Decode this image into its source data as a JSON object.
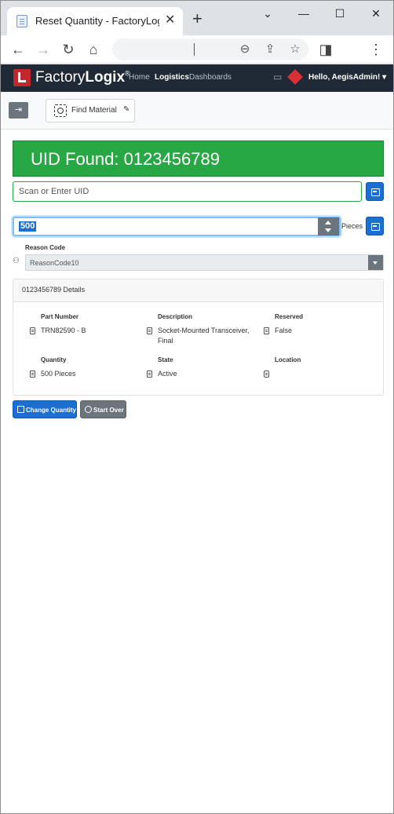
{
  "browser": {
    "tab_title": "Reset Quantity - FactoryLogix",
    "tab_close": "✕",
    "new_tab": "+",
    "minimize": "—",
    "maximize": "☐",
    "close": "✕"
  },
  "nav": {
    "brand_regular": "Factory",
    "brand_bold": "Logix",
    "brand_mark": "®",
    "links": [
      "Home",
      "Logistics",
      "Dashboards"
    ],
    "active_link": "Logistics",
    "user": "Hello, AegisAdmin! ▾"
  },
  "actionbar": {
    "find_material_label": "Find Material"
  },
  "main": {
    "found_text": "UID Found: 0123456789",
    "uid_placeholder": "Scan or Enter UID",
    "quantity_value": "500",
    "pieces_label": "Pieces",
    "reason_code_label": "Reason Code",
    "reason_code_value": "ReasonCode10"
  },
  "details": {
    "title": "0123456789 Details",
    "part_number_label": "Part Number",
    "part_number_value": "TRN82590 - B",
    "description_label": "Description",
    "description_value": "Socket-Mounted Transceiver, Final",
    "reserved_label": "Reserved",
    "reserved_value": "False",
    "quantity_label": "Quantity",
    "quantity_value": "500 Pieces",
    "state_label": "State",
    "state_value": "Active",
    "location_label": "Location",
    "location_value": ""
  },
  "buttons": {
    "change_quantity": "Change Quantity",
    "start_over": "Start Over"
  },
  "colors": {
    "success": "#28a745",
    "primary": "#1c6ed1",
    "secondary": "#6c757d",
    "navbar": "#1f2a36"
  }
}
